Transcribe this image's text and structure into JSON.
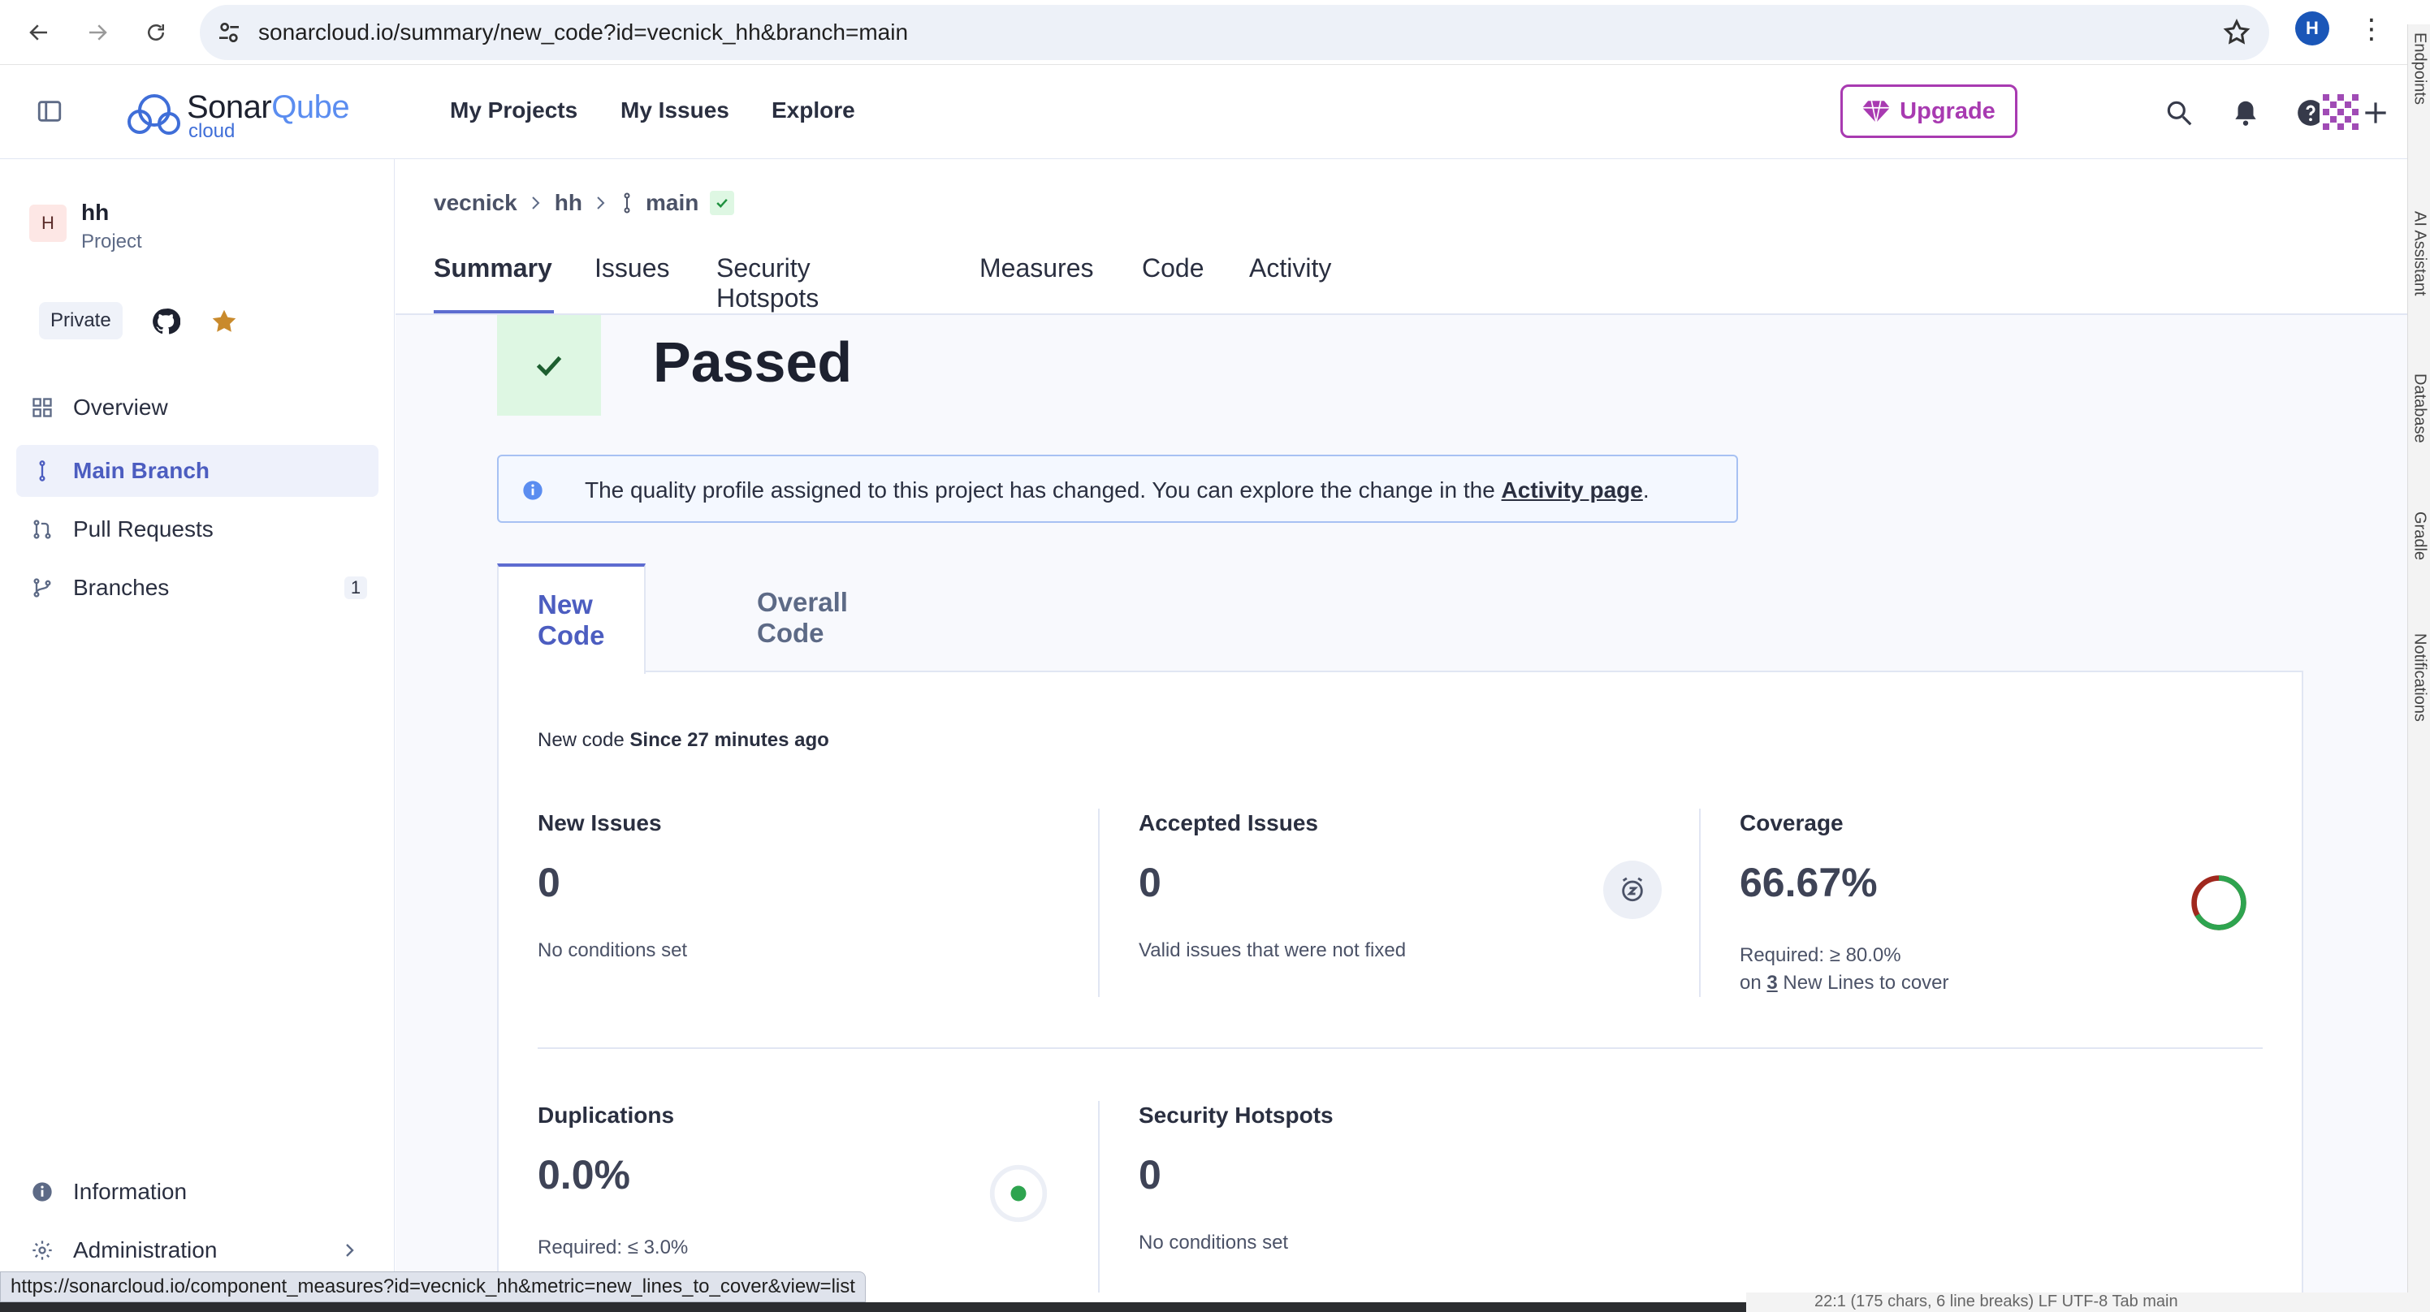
{
  "browser": {
    "url": "sonarcloud.io/summary/new_code?id=vecnick_hh&branch=main",
    "profile_initial": "H"
  },
  "header": {
    "brand_main": "Sonar",
    "brand_accent": "Qube",
    "brand_sub": "cloud",
    "nav": [
      "My Projects",
      "My Issues",
      "Explore"
    ],
    "upgrade_label": "Upgrade"
  },
  "sidebar": {
    "project_initial": "H",
    "project_name": "hh",
    "project_type": "Project",
    "visibility": "Private",
    "items": [
      {
        "label": "Overview"
      },
      {
        "label": "Main Branch"
      },
      {
        "label": "Pull Requests"
      },
      {
        "label": "Branches",
        "count": "1"
      }
    ],
    "bottom_items": [
      {
        "label": "Information"
      },
      {
        "label": "Administration"
      }
    ]
  },
  "breadcrumb": {
    "org": "vecnick",
    "project": "hh",
    "branch": "main"
  },
  "tabs": [
    "Summary",
    "Issues",
    "Security Hotspots",
    "Measures",
    "Code",
    "Activity"
  ],
  "quality_gate": {
    "status": "Passed"
  },
  "notice": {
    "text": "The quality profile assigned to this project has changed. You can explore the change in the ",
    "link": "Activity page",
    "end": "."
  },
  "code_tabs": [
    "New Code",
    "Overall Code"
  ],
  "new_code": {
    "prefix": "New code",
    "since": "Since 27 minutes ago"
  },
  "metrics": {
    "new_issues": {
      "label": "New Issues",
      "value": "0",
      "sub": "No conditions set"
    },
    "accepted_issues": {
      "label": "Accepted Issues",
      "value": "0",
      "sub": "Valid issues that were not fixed"
    },
    "coverage": {
      "label": "Coverage",
      "value": "66.67%",
      "required": "Required: ≥ 80.0%",
      "on": "on",
      "lines": "3",
      "lines_suffix": "New Lines to cover",
      "fraction": 0.6667
    },
    "duplications": {
      "label": "Duplications",
      "value": "0.0%",
      "required": "Required: ≤ 3.0%"
    },
    "security_hotspots": {
      "label": "Security Hotspots",
      "value": "0",
      "sub": "No conditions set"
    }
  },
  "status_bar": {
    "link_preview": "https://sonarcloud.io/component_measures?id=vecnick_hh&metric=new_lines_to_cover&view=list",
    "ide_text": "22:1 (175 chars, 6 line breaks)   LF   UTF-8   Tab   main"
  },
  "tool_window": [
    "Endpoints",
    "AI Assistant",
    "Database",
    "Gradle",
    "Notifications"
  ],
  "colors": {
    "accent": "#5d6cd0",
    "upgrade": "#a83ab1",
    "passed": "#def7e3",
    "coverage_good": "#2ea44f",
    "coverage_bad": "#a0281e"
  }
}
